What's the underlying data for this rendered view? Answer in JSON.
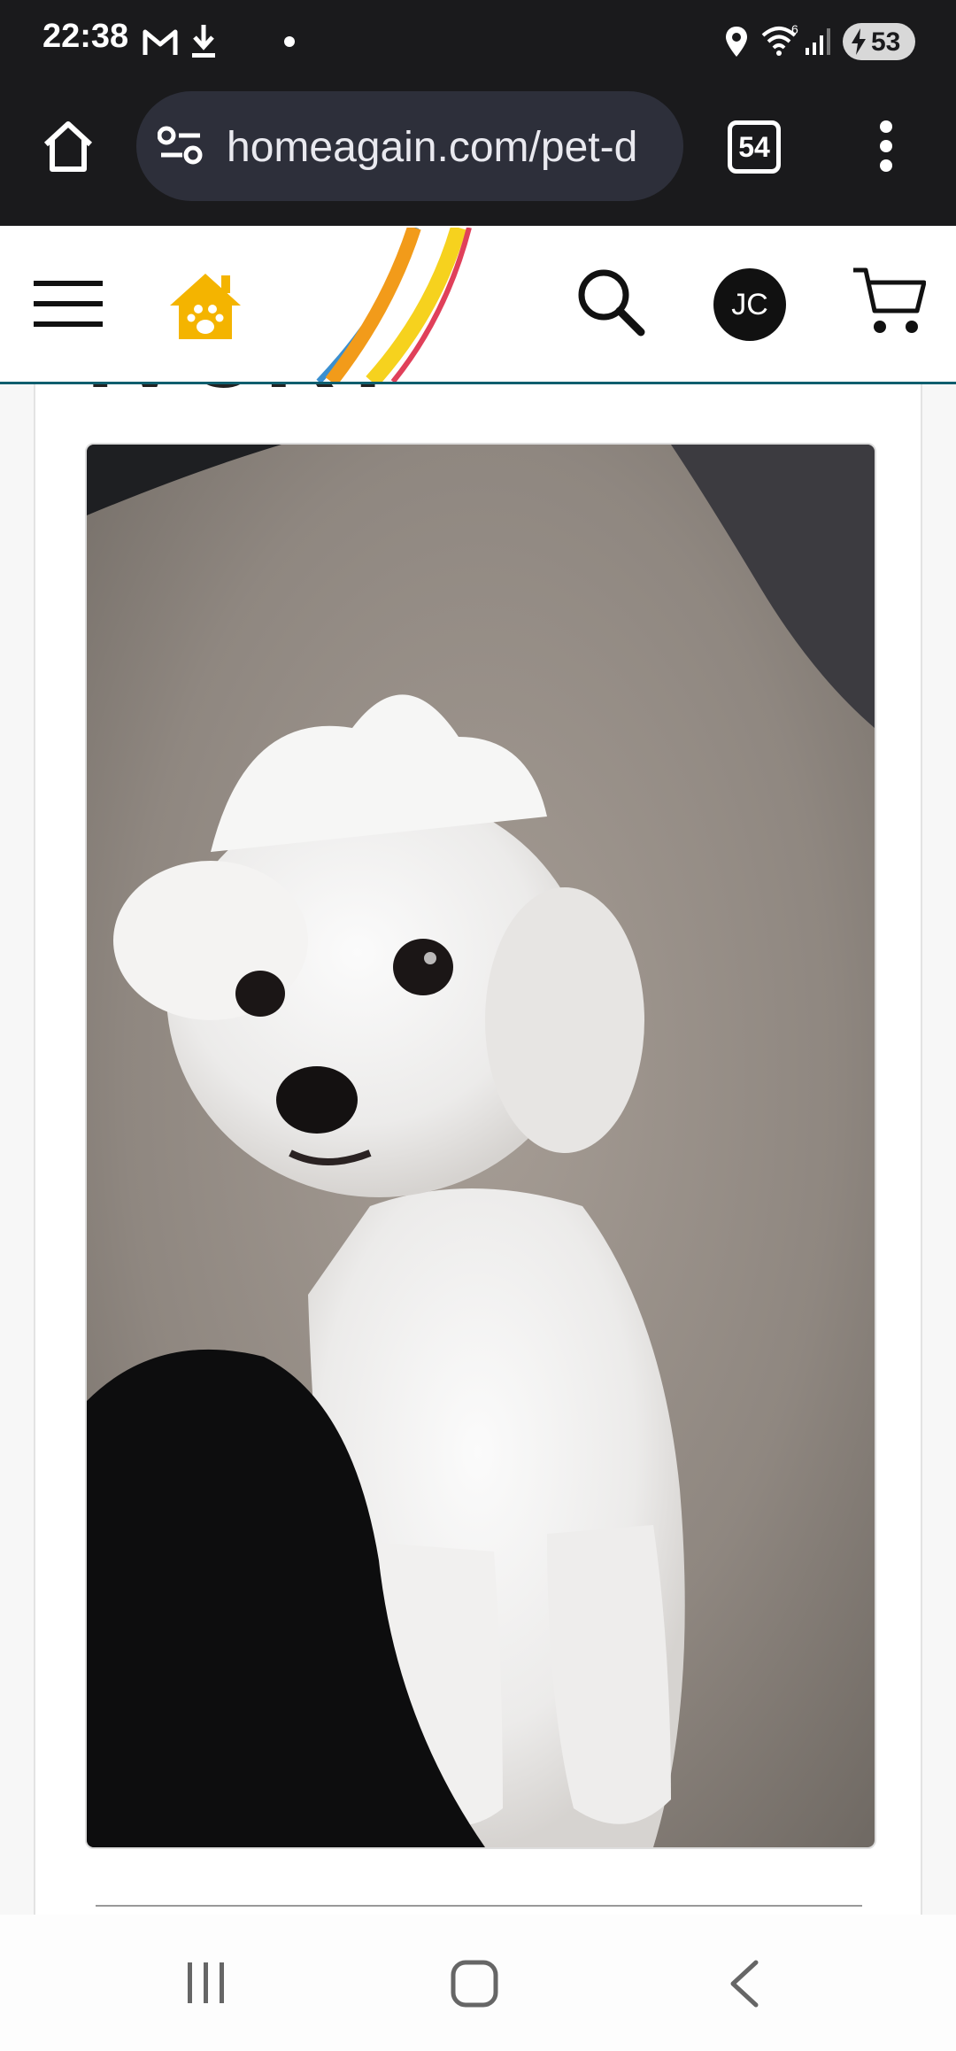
{
  "status_bar": {
    "time": "22:38",
    "battery": "53",
    "icons": [
      "gmail-icon",
      "download-icon",
      "dot-icon",
      "location-icon",
      "wifi-icon",
      "signal-icon",
      "battery-icon"
    ]
  },
  "browser": {
    "url": "homeagain.com/pet-d",
    "tab_count": "54",
    "icons": [
      "home-icon",
      "site-settings-icon",
      "menu-dots-icon"
    ]
  },
  "site_header": {
    "avatar_initials": "JC",
    "brand_color": "#f4b400",
    "icons": [
      "hamburger-icon",
      "homeagain-logo-icon",
      "search-icon",
      "cart-icon"
    ]
  },
  "content": {
    "pet_name": "IVORY",
    "photo_alt": "white dog photo"
  },
  "nav_bar": {
    "icons": [
      "recents-icon",
      "home-nav-icon",
      "back-icon"
    ]
  }
}
